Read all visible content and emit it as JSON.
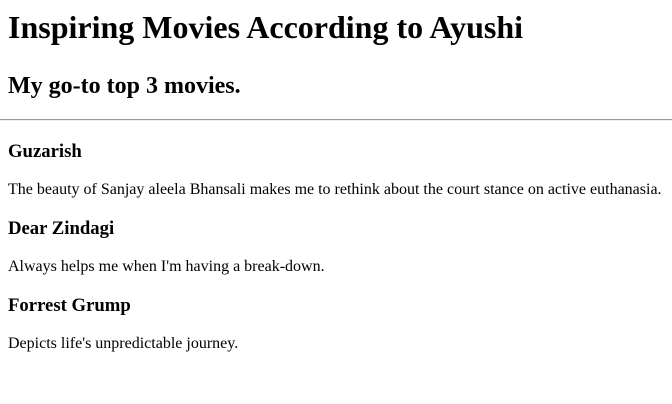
{
  "page": {
    "title": "Inspiring Movies According to Ayushi",
    "subtitle": "My go-to top 3 movies."
  },
  "movies": [
    {
      "title": "Guzarish",
      "description": "The beauty of Sanjay aleela Bhansali makes me to rethink about the court stance on active euthanasia."
    },
    {
      "title": "Dear Zindagi",
      "description": "Always helps me when I'm having a break-down."
    },
    {
      "title": "Forrest Grump",
      "description": "Depicts life's unpredictable journey."
    }
  ]
}
